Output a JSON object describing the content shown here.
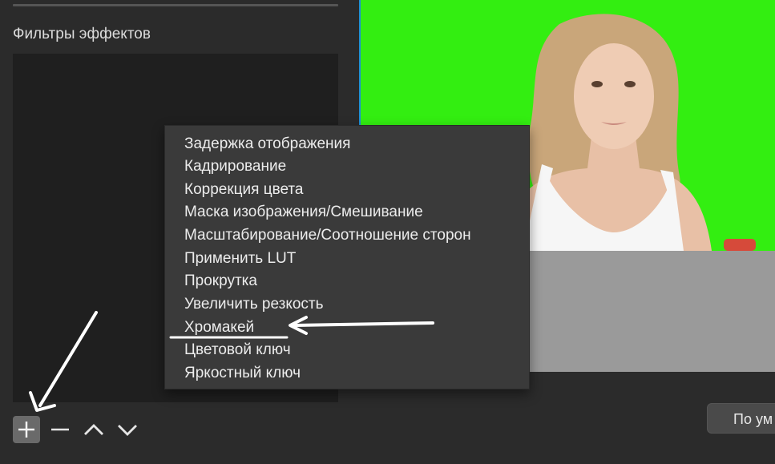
{
  "filters_panel": {
    "title": "Фильтры эффектов"
  },
  "toolbar": {
    "buttons": [
      {
        "icon": "plus-icon"
      },
      {
        "icon": "minus-icon"
      },
      {
        "icon": "chevron-up-icon"
      },
      {
        "icon": "chevron-down-icon"
      }
    ]
  },
  "preview": {
    "background_color": "#33ee11"
  },
  "default_button_label": "По ум",
  "context_menu": {
    "items": [
      "Задержка отображения",
      "Кадрирование",
      "Коррекция цвета",
      "Маска изображения/Смешивание",
      "Масштабирование/Соотношение сторон",
      "Применить LUT",
      "Прокрутка",
      "Увеличить резкость",
      "Хромакей",
      "Цветовой ключ",
      "Яркостный ключ"
    ],
    "highlighted_item": "Хромакей"
  },
  "annotations": {
    "arrows": [
      "arrow-to-add-button",
      "arrow-to-chromakey"
    ],
    "underline_target": "Хромакей"
  }
}
